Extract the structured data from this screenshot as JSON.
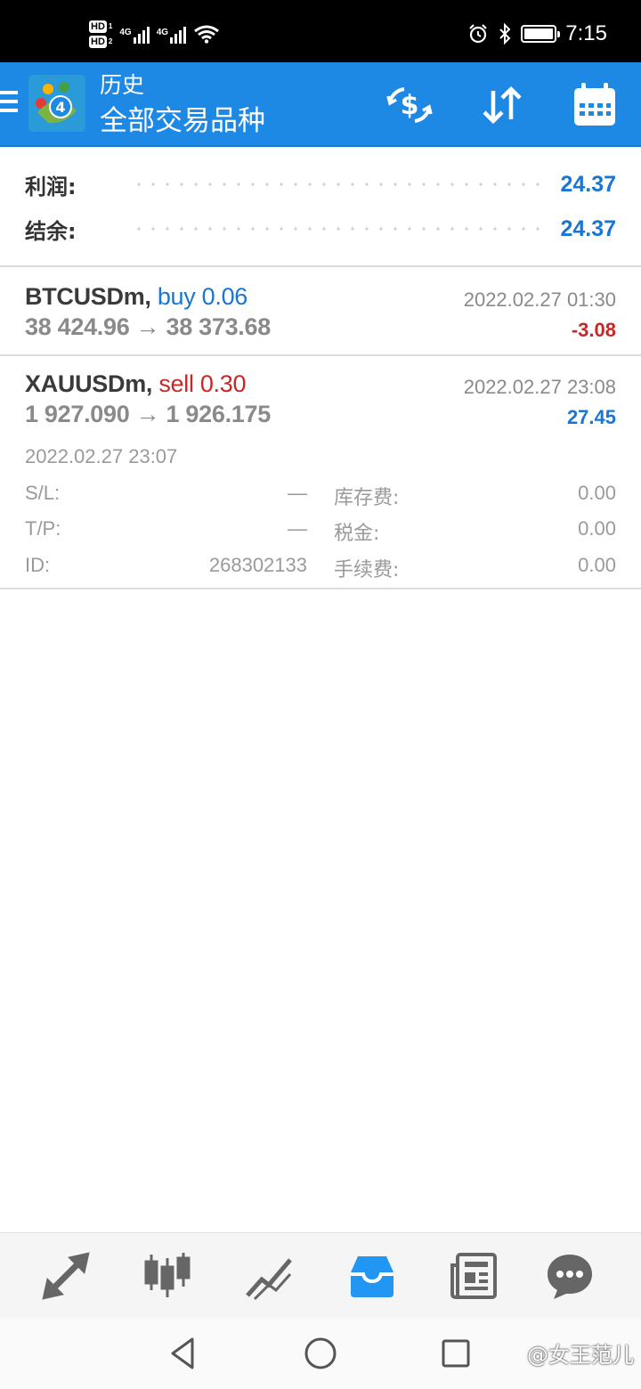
{
  "status_bar": {
    "sim1": "HD",
    "sim1_num": "1",
    "sim2": "HD",
    "sim2_num": "2",
    "network1": "4G",
    "network2": "4G",
    "time": "7:15"
  },
  "app_bar": {
    "title": "历史",
    "subtitle": "全部交易品种",
    "icons": [
      "menu-icon",
      "metatrader-logo",
      "currency-exchange-icon",
      "sort-icon",
      "calendar-icon"
    ]
  },
  "summary": {
    "profit_label": "利润:",
    "profit_value": "24.37",
    "balance_label": "结余:",
    "balance_value": "24.37"
  },
  "trades": [
    {
      "symbol": "BTCUSDm,",
      "side_volume": "buy 0.06",
      "prices": "38 424.96 → 38 373.68",
      "close_time": "2022.02.27 01:30",
      "profit": "-3.08"
    },
    {
      "symbol": "XAUUSDm,",
      "side_volume": "sell 0.30",
      "prices": "1 927.090 → 1 926.175",
      "close_time": "2022.02.27 23:08",
      "profit": "27.45",
      "open_time": "2022.02.27 23:07",
      "sl_label": "S/L:",
      "sl_value": "—",
      "tp_label": "T/P:",
      "tp_value": "—",
      "id_label": "ID:",
      "id_value": "268302133",
      "swap_label": "库存费:",
      "swap_value": "0.00",
      "tax_label": "税金:",
      "tax_value": "0.00",
      "commission_label": "手续费:",
      "commission_value": "0.00"
    }
  ],
  "bottom_nav": {
    "items": [
      "trade-icon",
      "quotes-icon",
      "chart-icon",
      "history-icon",
      "news-icon",
      "messages-icon"
    ],
    "active": "history-icon"
  },
  "system_nav": {
    "watermark": "@女王范儿"
  },
  "colors": {
    "accent": "#1e88e5",
    "positive": "#1976d2",
    "negative": "#c62828"
  }
}
